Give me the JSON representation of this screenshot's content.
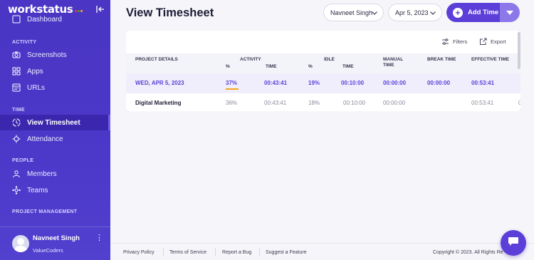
{
  "app": {
    "logo_text": "workstatus",
    "logo_dot_colors": [
      "#e53935",
      "#43a047",
      "#ffb300"
    ]
  },
  "sidebar": {
    "partial_item": "Dashboard",
    "sections": {
      "activity": "ACTIVITY",
      "time": "TIME",
      "people": "PEOPLE",
      "project_management": "PROJECT MANAGEMENT"
    },
    "items": {
      "screenshots": "Screenshots",
      "apps": "Apps",
      "urls": "URLs",
      "view_timesheet": "View Timesheet",
      "attendance": "Attendance",
      "members": "Members",
      "teams": "Teams"
    },
    "active_item": "View Timesheet",
    "user": {
      "name": "Navneet Singh",
      "org": "ValueCoders"
    }
  },
  "header": {
    "title": "View Timesheet",
    "member_select": "Navneet Singh",
    "date_select": "Apr 5, 2023",
    "add_time_label": "Add Time",
    "accent_color": "#5b3fd8"
  },
  "toolbar": {
    "filters_label": "Filters",
    "export_label": "Export"
  },
  "table": {
    "headers": {
      "project_details": "PROJECT DETAILS",
      "activity": "ACTIVITY",
      "activity_pct": "%",
      "activity_time": "TIME",
      "idle_pct": "%",
      "idle": "IDLE",
      "idle_time": "TIME",
      "manual_time_1": "MANUAL",
      "manual_time_2": "TIME",
      "break_time": "BREAK TIME",
      "effective_time": "EFFECTIVE TIME",
      "cut_off": "D"
    },
    "day_row": {
      "date": "WED, APR 5, 2023",
      "activity_pct": "37%",
      "activity_pct_value": 37,
      "activity_time": "00:43:41",
      "idle_pct": "19%",
      "idle_time": "00:10:00",
      "manual_time": "00:00:00",
      "break_time": "00:00:00",
      "effective_time": "00:53:41"
    },
    "project_row": {
      "project": "Digital Marketing",
      "activity_pct": "36%",
      "activity_time": "00:43:41",
      "idle_pct": "18%",
      "idle_time": "00:10:00",
      "manual_time": "00:00:00",
      "break_time": "",
      "effective_time": "00:53:41",
      "cut_off": "0"
    }
  },
  "footer": {
    "privacy": "Privacy Policy",
    "terms": "Terms of Service",
    "report_bug": "Report a Bug",
    "suggest_feature": "Suggest a Feature",
    "copyright": "Copyright © 2023. All Rights Re"
  }
}
